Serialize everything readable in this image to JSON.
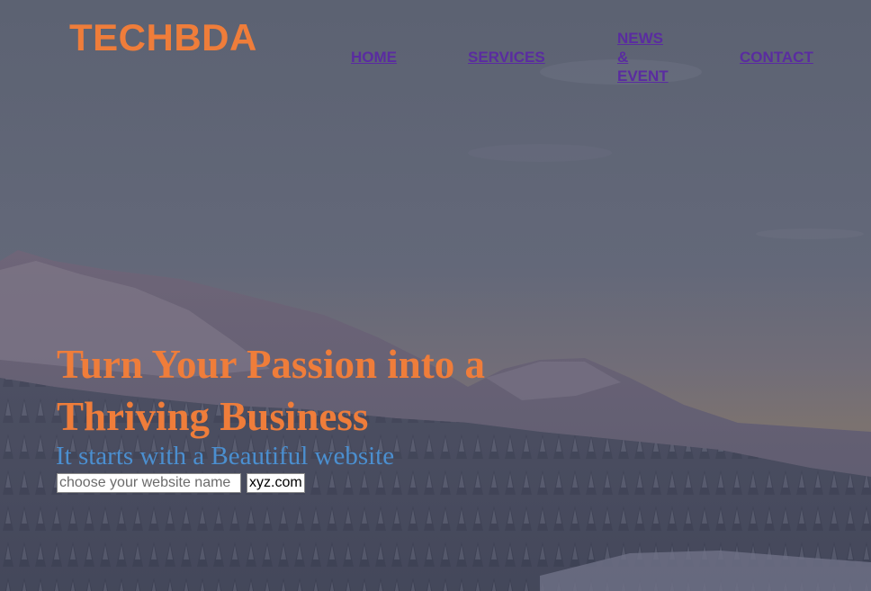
{
  "brand": {
    "logo_text": "TECHBDA",
    "accent_color": "#ef7d3a"
  },
  "nav": {
    "link_color": "#5a2ca0",
    "items": [
      {
        "label": "HOME"
      },
      {
        "label": "SERVICES"
      },
      {
        "label": "NEWS & EVENT"
      },
      {
        "label": "CONTACT"
      }
    ]
  },
  "hero": {
    "background": "mountain landscape with snowy pine forest",
    "headline": "Turn Your Passion into a Thriving Business",
    "tagline": "It starts with a Beautiful website",
    "tagline_color": "#4b8fd0",
    "domain_search": {
      "placeholder": "choose your website name",
      "value": "",
      "tld_selected": "xyz.com"
    }
  }
}
